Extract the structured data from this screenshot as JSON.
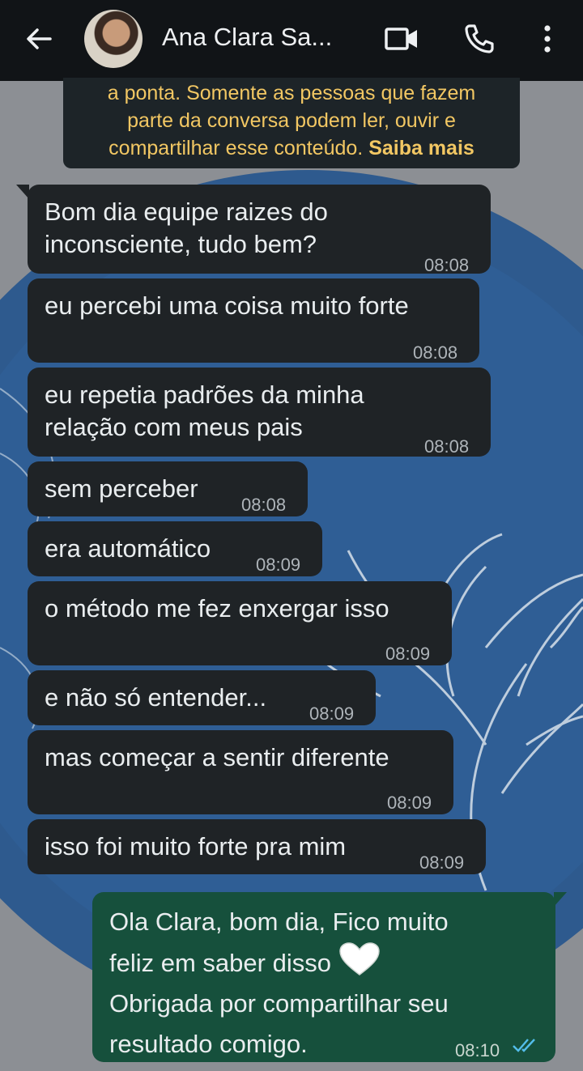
{
  "header": {
    "contact_name": "Ana Clara Sa...",
    "icons": [
      "back-arrow-icon",
      "video-camera-icon",
      "phone-icon",
      "more-vert-icon"
    ]
  },
  "notice": {
    "line1": "a ponta. Somente as pessoas que fazem",
    "line2": "parte da conversa podem ler, ouvir e",
    "line3_prefix": "compartilhar esse conteúdo.",
    "learn_more": "Saiba mais"
  },
  "messages": [
    {
      "lines": [
        "Bom dia equipe raizes do",
        "inconsciente, tudo bem?"
      ],
      "time": "08:08"
    },
    {
      "lines": [
        "eu percebi uma coisa muito forte"
      ],
      "time": "08:08"
    },
    {
      "lines": [
        "eu repetia padrões da minha",
        "relação com meus pais"
      ],
      "time": "08:08"
    },
    {
      "lines": [
        "sem perceber"
      ],
      "time": "08:08"
    },
    {
      "lines": [
        "era automático"
      ],
      "time": "08:09"
    },
    {
      "lines": [
        "o método me fez enxergar isso"
      ],
      "time": "08:09"
    },
    {
      "lines": [
        "e não só entender..."
      ],
      "time": "08:09"
    },
    {
      "lines": [
        "mas começar a sentir diferente"
      ],
      "time": "08:09"
    },
    {
      "lines": [
        "isso foi muito forte pra mim"
      ],
      "time": "08:09"
    }
  ],
  "reply": {
    "lines": [
      "Ola Clara, bom dia, Fico muito",
      "feliz em saber disso",
      "Obrigada por compartilhar seu",
      "resultado comigo."
    ],
    "time": "08:10",
    "status_icon": "double-check-read-icon",
    "emoji": "white-heart-icon"
  },
  "colors": {
    "header_bg": "#111417",
    "incoming_bubble": "#1f2326",
    "outgoing_bubble": "#16503c",
    "notice_text": "#f2c763",
    "read_ticks": "#53bdeb"
  }
}
